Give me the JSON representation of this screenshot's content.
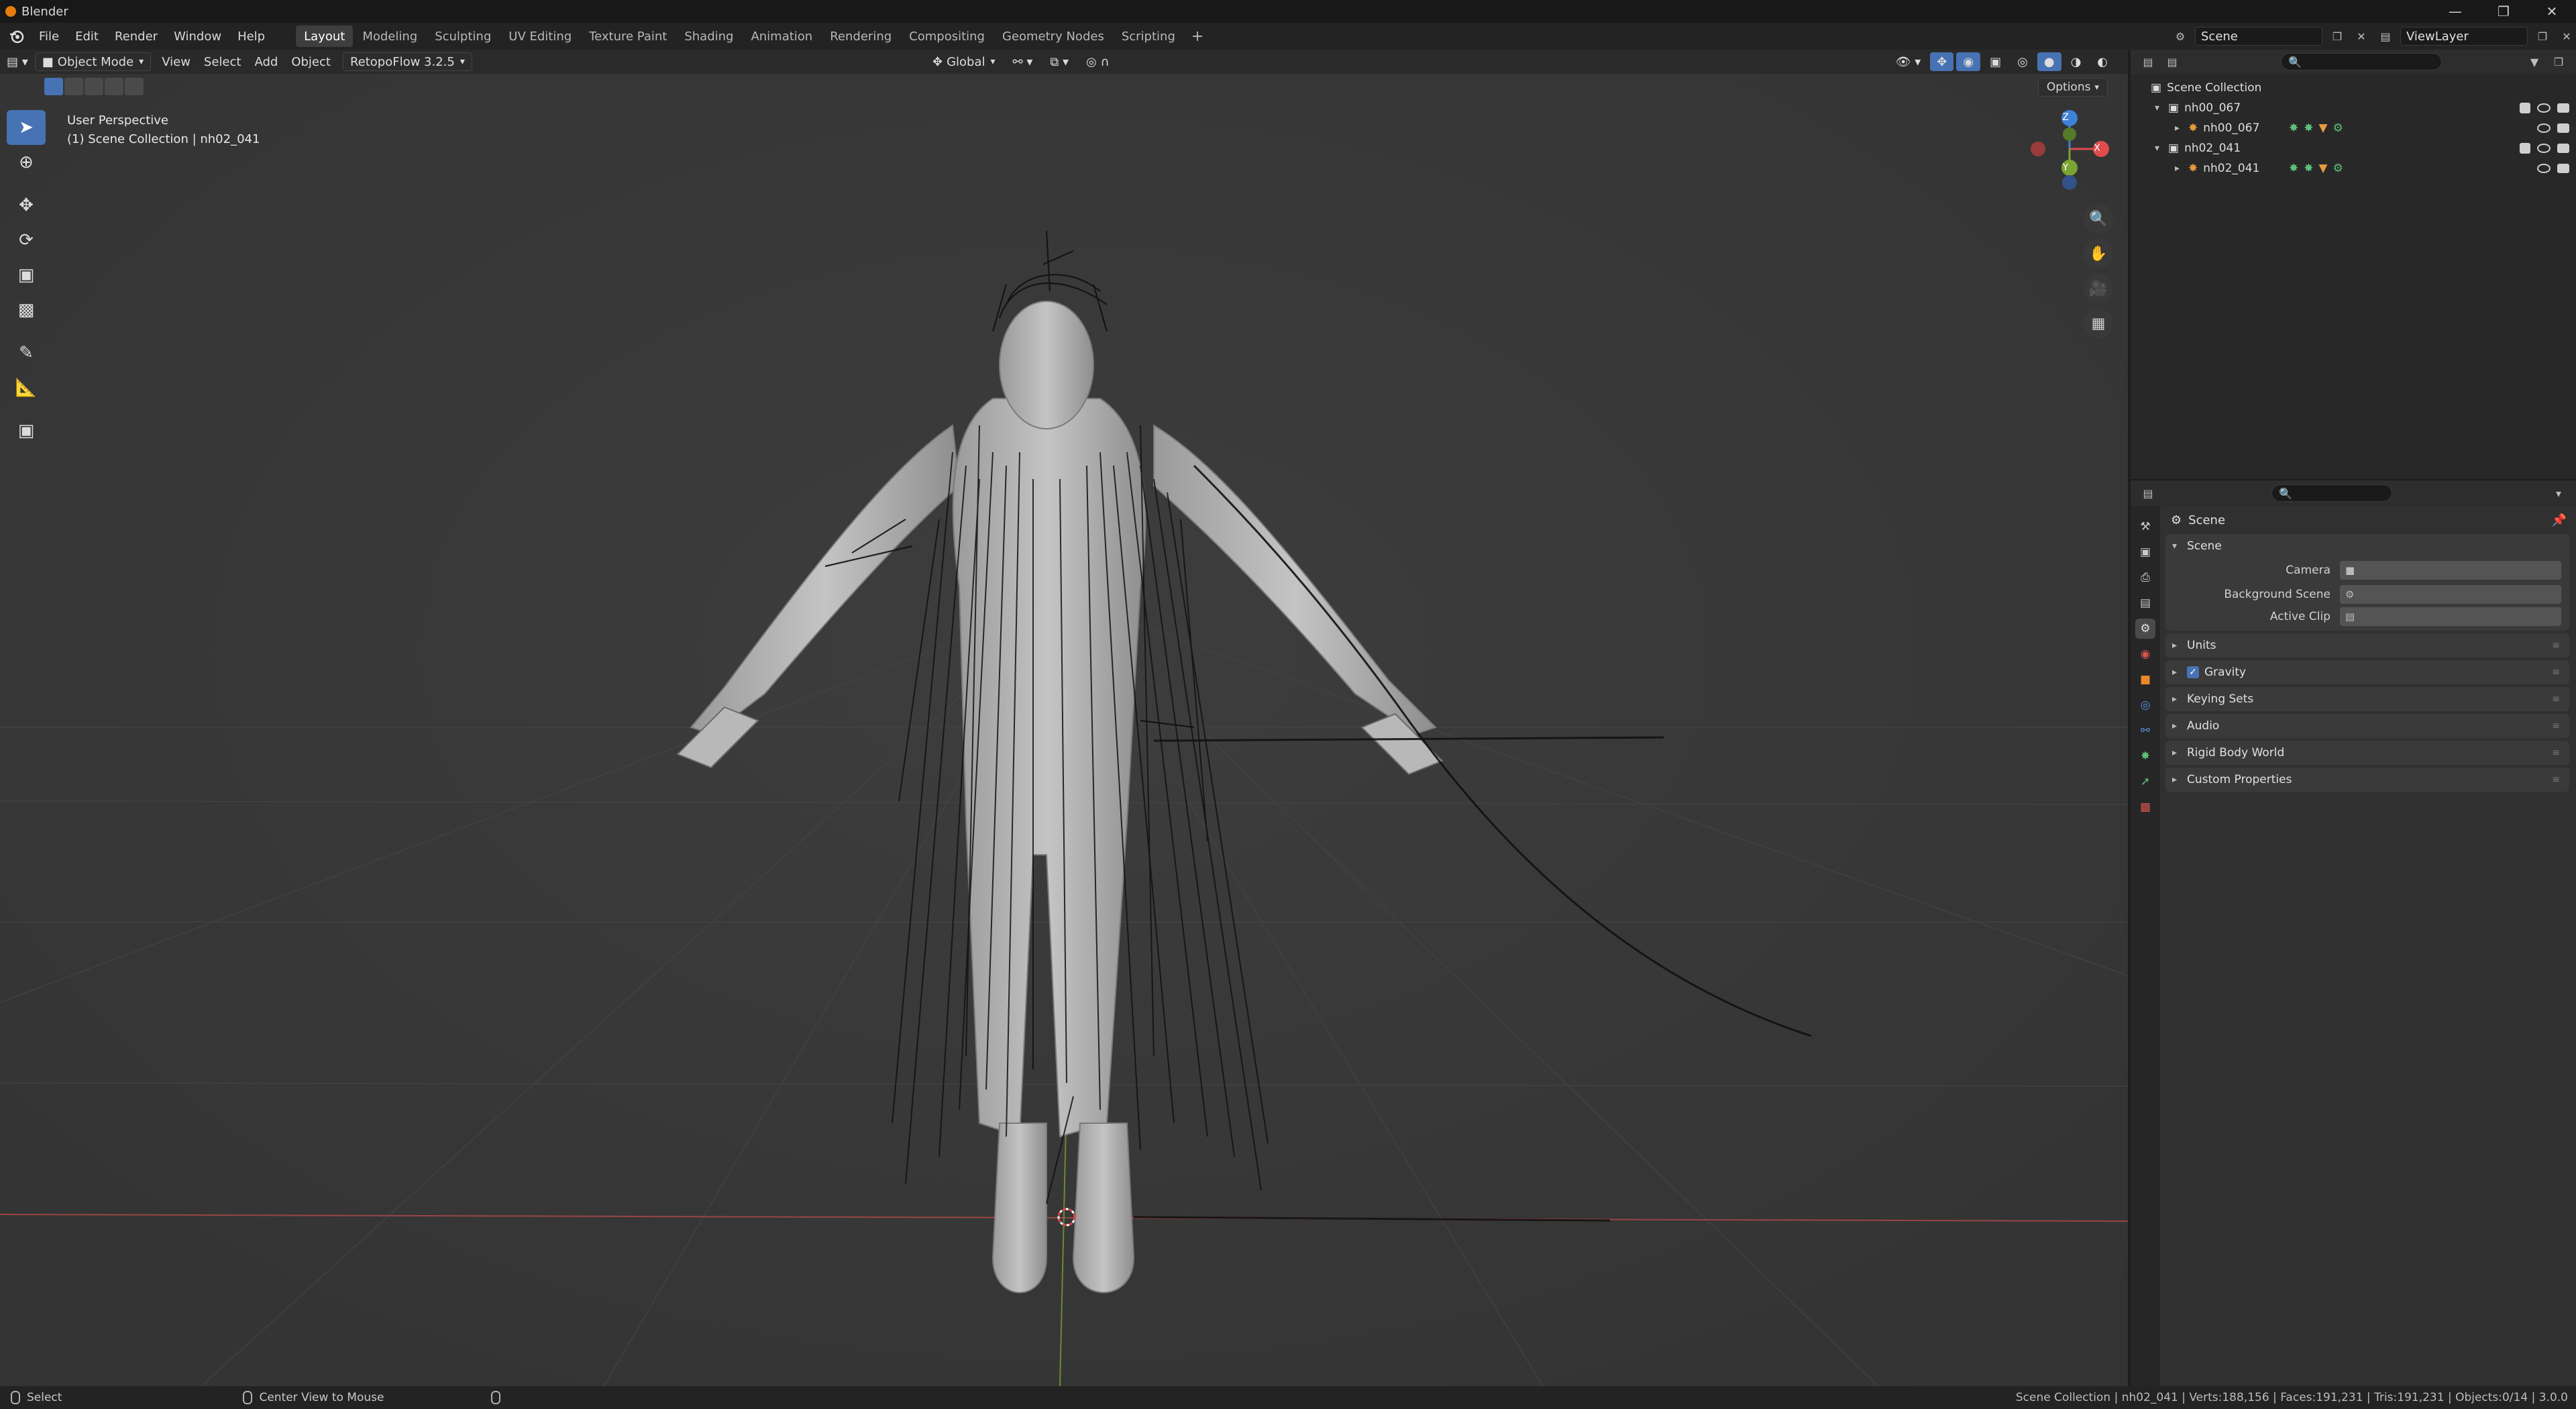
{
  "window": {
    "title": "Blender"
  },
  "menu": {
    "items": [
      "File",
      "Edit",
      "Render",
      "Window",
      "Help"
    ],
    "workspaces": [
      "Layout",
      "Modeling",
      "Sculpting",
      "UV Editing",
      "Texture Paint",
      "Shading",
      "Animation",
      "Rendering",
      "Compositing",
      "Geometry Nodes",
      "Scripting"
    ],
    "active_workspace": "Layout",
    "scene_name": "Scene",
    "view_layer": "ViewLayer"
  },
  "viewport": {
    "mode": "Object Mode",
    "menus": [
      "View",
      "Select",
      "Add",
      "Object"
    ],
    "addon": "RetopoFlow 3.2.5",
    "transform_orientation": "Global",
    "options_label": "Options",
    "info_line1": "User Perspective",
    "info_line2": "(1) Scene Collection | nh02_041",
    "gizmo_labels": {
      "z": "Z",
      "y": "Y",
      "x": "X"
    }
  },
  "outliner": {
    "root": "Scene Collection",
    "rows": [
      {
        "name": "nh00_067",
        "level": 1
      },
      {
        "name": "nh00_067",
        "level": 2
      },
      {
        "name": "nh02_041",
        "level": 1
      },
      {
        "name": "nh02_041",
        "level": 2
      }
    ]
  },
  "properties": {
    "context_title": "Scene",
    "panel_title": "Scene",
    "fields": [
      {
        "label": "Camera"
      },
      {
        "label": "Background Scene"
      },
      {
        "label": "Active Clip"
      }
    ],
    "subpanels": [
      "Units",
      "Gravity",
      "Keying Sets",
      "Audio",
      "Rigid Body World",
      "Custom Properties"
    ],
    "gravity_checked": true,
    "tab_colors": [
      "#c8c8c8",
      "#c8c8c8",
      "#c8c8c8",
      "#c8c8c8",
      "#e0e0e0",
      "#d9534f",
      "#e8892c",
      "#5b8de0",
      "#5b8de0",
      "#5fbf7a",
      "#5fbf7a",
      "#d9534f"
    ]
  },
  "statusbar": {
    "left_action": "Select",
    "middle_action": "Center View to Mouse",
    "stats": "Scene Collection | nh02_041 | Verts:188,156 | Faces:191,231 | Tris:191,231 | Objects:0/14 | 3.0.0"
  },
  "colors": {
    "accent": "#4772b3",
    "x_axis": "#e04c4c",
    "y_axis": "#7ba531",
    "z_axis": "#3d82d8"
  }
}
